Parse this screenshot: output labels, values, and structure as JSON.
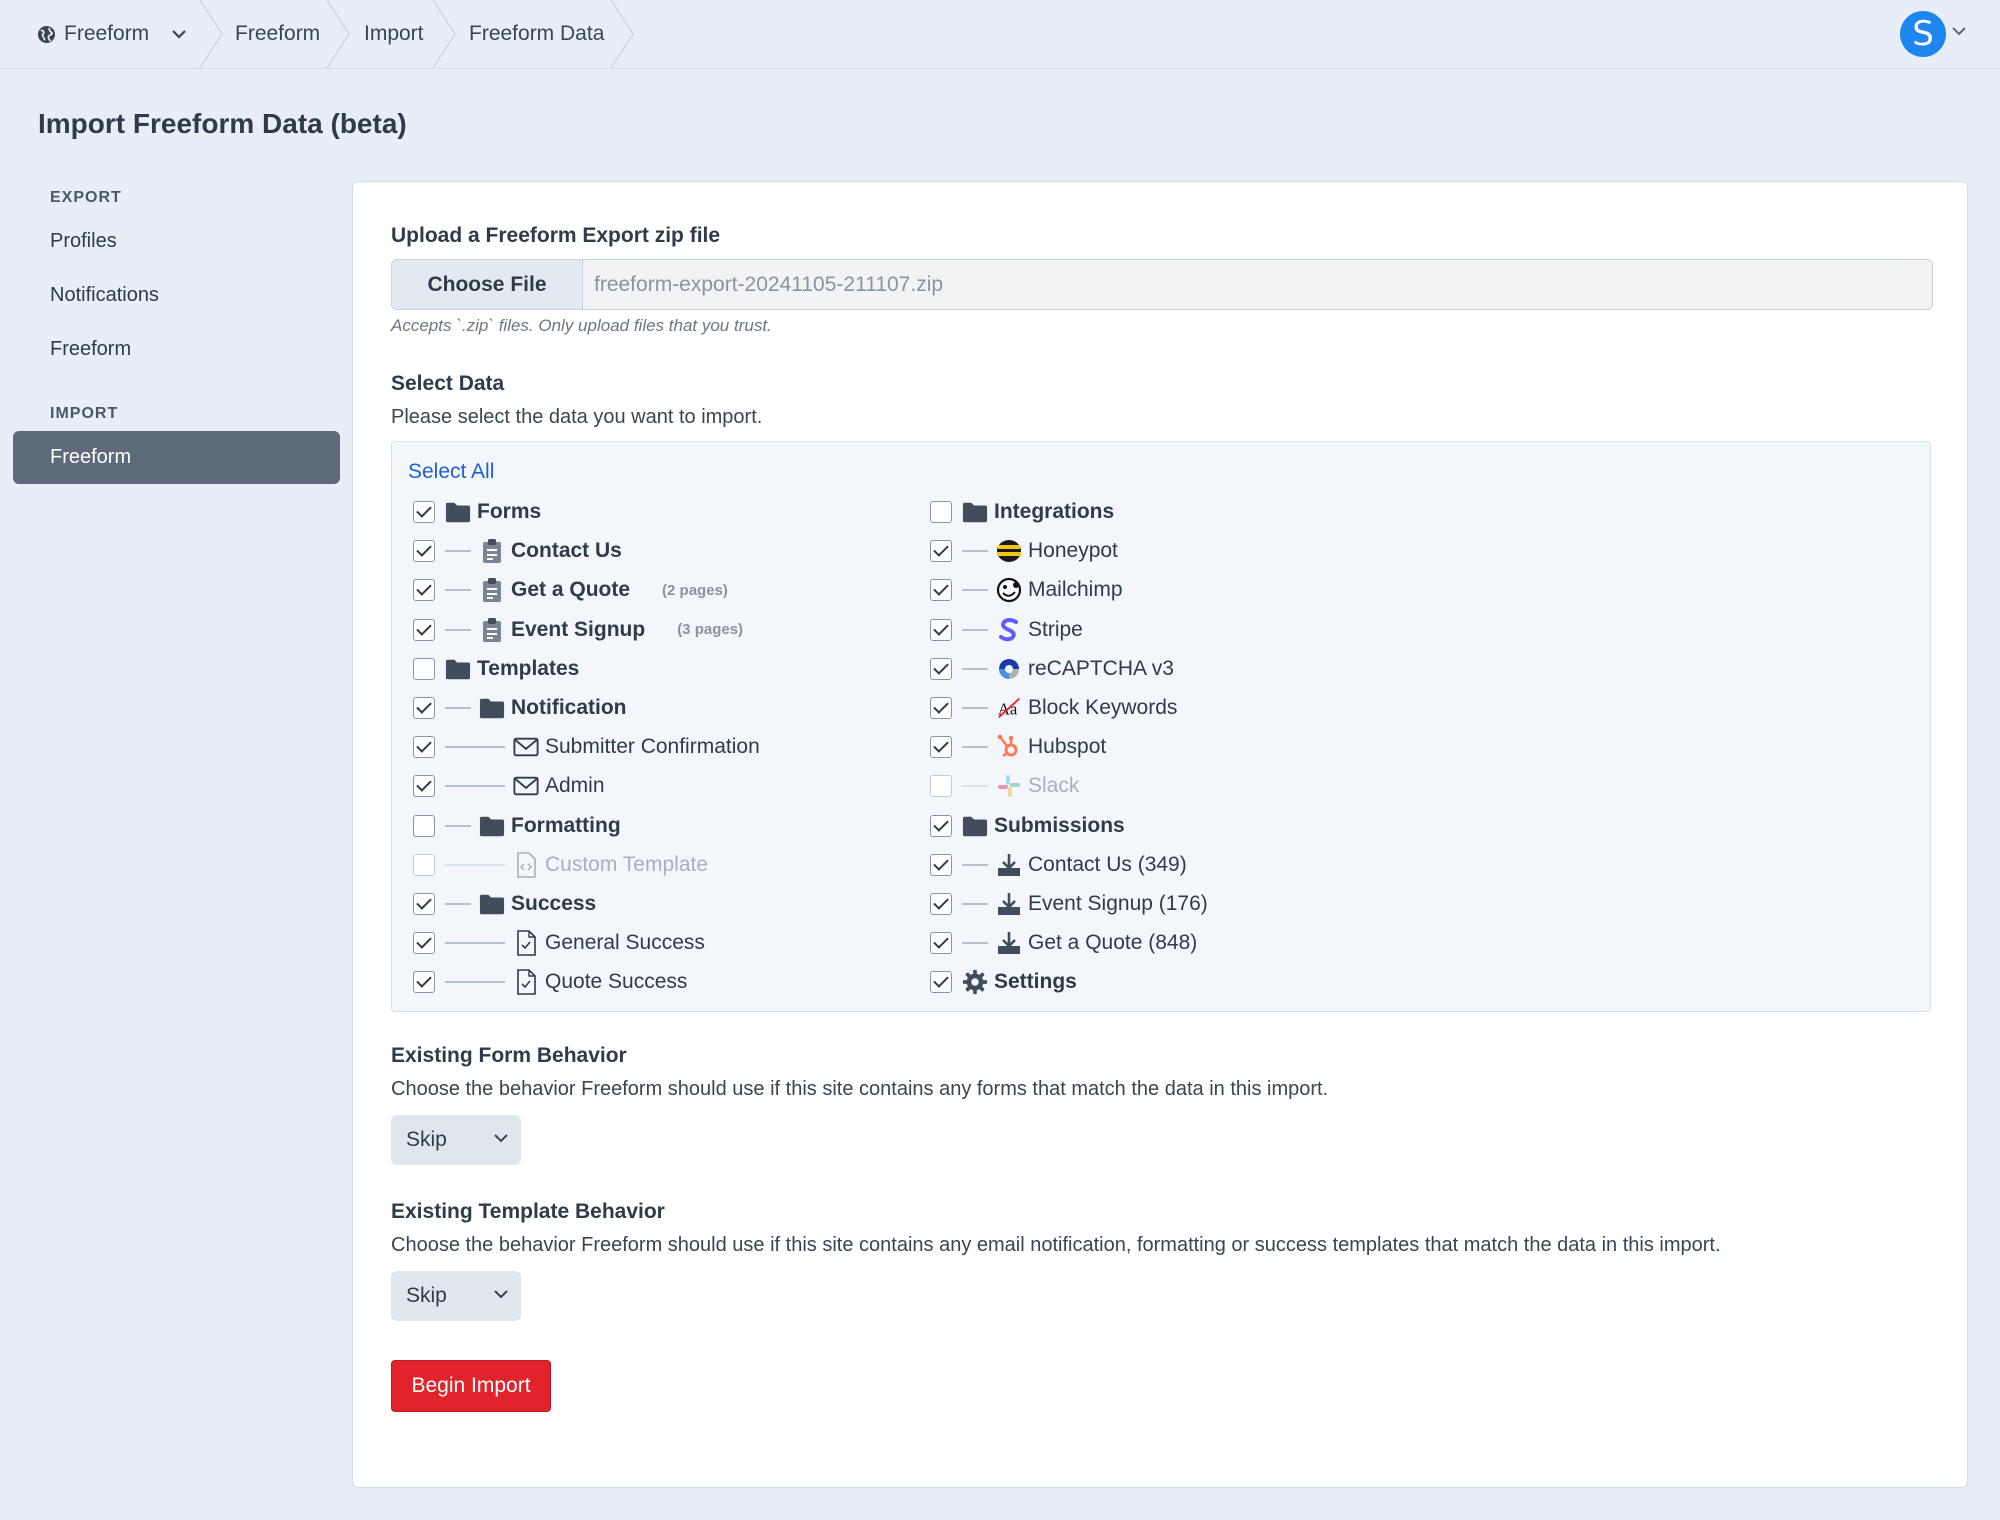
{
  "topbar": {
    "site": "Freeform",
    "breadcrumbs": [
      "Freeform",
      "Import",
      "Freeform Data"
    ],
    "avatar_letter": "S"
  },
  "page_title": "Import Freeform Data (beta)",
  "sidebar": {
    "export_heading": "EXPORT",
    "export_items": [
      "Profiles",
      "Notifications",
      "Freeform"
    ],
    "import_heading": "IMPORT",
    "import_items": [
      "Freeform"
    ]
  },
  "upload": {
    "label": "Upload a Freeform Export zip file",
    "button": "Choose File",
    "filename": "freeform-export-20241105-211107.zip",
    "hint": "Accepts `.zip` files. Only upload files that you trust."
  },
  "select_data": {
    "label": "Select Data",
    "description": "Please select the data you want to import.",
    "select_all": "Select All",
    "left": [
      {
        "label": "Forms",
        "checked": true,
        "level": 0,
        "icon": "folder-icon",
        "bold": true
      },
      {
        "label": "Contact Us",
        "checked": true,
        "level": 1,
        "icon": "clipboard-icon",
        "bold": true
      },
      {
        "label": "Get a Quote",
        "checked": true,
        "level": 1,
        "icon": "clipboard-icon",
        "bold": true,
        "pages": "(2 pages)"
      },
      {
        "label": "Event Signup",
        "checked": true,
        "level": 1,
        "icon": "clipboard-icon",
        "bold": true,
        "pages": "(3 pages)"
      },
      {
        "label": "Templates",
        "checked": false,
        "level": 0,
        "icon": "folder-icon",
        "bold": true
      },
      {
        "label": "Notification",
        "checked": true,
        "level": 1,
        "icon": "folder-icon",
        "bold": true
      },
      {
        "label": "Submitter Confirmation",
        "checked": true,
        "level": 2,
        "icon": "envelope-icon",
        "bold": false
      },
      {
        "label": "Admin",
        "checked": true,
        "level": 2,
        "icon": "envelope-icon",
        "bold": false
      },
      {
        "label": "Formatting",
        "checked": false,
        "level": 1,
        "icon": "folder-icon",
        "bold": true
      },
      {
        "label": "Custom Template",
        "checked": false,
        "level": 2,
        "icon": "code-file-icon",
        "bold": false,
        "dim": true
      },
      {
        "label": "Success",
        "checked": true,
        "level": 1,
        "icon": "folder-icon",
        "bold": true
      },
      {
        "label": "General Success",
        "checked": true,
        "level": 2,
        "icon": "check-file-icon",
        "bold": false
      },
      {
        "label": "Quote Success",
        "checked": true,
        "level": 2,
        "icon": "check-file-icon",
        "bold": false
      }
    ],
    "right": [
      {
        "label": "Integrations",
        "checked": false,
        "level": 0,
        "icon": "folder-icon",
        "bold": true
      },
      {
        "label": "Honeypot",
        "checked": true,
        "level": 1,
        "icon": "honeypot-icon",
        "bold": false
      },
      {
        "label": "Mailchimp",
        "checked": true,
        "level": 1,
        "icon": "mailchimp-icon",
        "bold": false
      },
      {
        "label": "Stripe",
        "checked": true,
        "level": 1,
        "icon": "stripe-icon",
        "bold": false
      },
      {
        "label": "reCAPTCHA v3",
        "checked": true,
        "level": 1,
        "icon": "recaptcha-icon",
        "bold": false
      },
      {
        "label": "Block Keywords",
        "checked": true,
        "level": 1,
        "icon": "block-keywords-icon",
        "bold": false
      },
      {
        "label": "Hubspot",
        "checked": true,
        "level": 1,
        "icon": "hubspot-icon",
        "bold": false
      },
      {
        "label": "Slack",
        "checked": false,
        "level": 1,
        "icon": "slack-icon",
        "bold": false,
        "dim": true
      },
      {
        "label": "Submissions",
        "checked": true,
        "level": 0,
        "icon": "folder-icon",
        "bold": true
      },
      {
        "label": "Contact Us (349)",
        "checked": true,
        "level": 1,
        "icon": "download-icon",
        "bold": false
      },
      {
        "label": "Event Signup (176)",
        "checked": true,
        "level": 1,
        "icon": "download-icon",
        "bold": false
      },
      {
        "label": "Get a Quote (848)",
        "checked": true,
        "level": 1,
        "icon": "download-icon",
        "bold": false
      },
      {
        "label": "Settings",
        "checked": true,
        "level": 0,
        "icon": "gear-icon",
        "bold": true
      }
    ]
  },
  "form_behavior": {
    "label": "Existing Form Behavior",
    "description": "Choose the behavior Freeform should use if this site contains any forms that match the data in this import.",
    "value": "Skip"
  },
  "template_behavior": {
    "label": "Existing Template Behavior",
    "description": "Choose the behavior Freeform should use if this site contains any email notification, formatting or success templates that match the data in this import.",
    "value": "Skip"
  },
  "begin_button": "Begin Import",
  "colors": {
    "accent": "#1f60d6",
    "danger": "#e1232c",
    "sidebar_active": "#5d6a79",
    "background": "#e7eef7"
  }
}
